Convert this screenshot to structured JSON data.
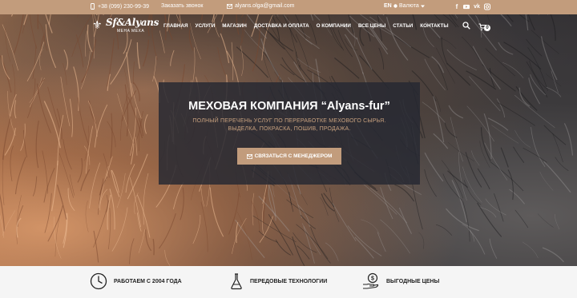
{
  "topbar": {
    "phone": "+38 (099) 230-99-39",
    "callback": "Заказать звонок",
    "email": "alyans.olga@gmail.com",
    "language": "EN",
    "currency": "Валюта",
    "socials": [
      "facebook-icon",
      "youtube-icon",
      "vk-icon",
      "instagram-icon"
    ]
  },
  "logo": {
    "brand": "Sf&Alyans",
    "sub": "MEHA MEXA"
  },
  "nav": {
    "items": [
      "ГЛАВНАЯ",
      "УСЛУГИ",
      "МАГАЗИН",
      "ДОСТАВКА И ОПЛАТА",
      "О КОМПАНИИ",
      "ВСЕ ЦЕНЫ",
      "СТАТЬИ",
      "КОНТАКТЫ"
    ],
    "cart_count": "0"
  },
  "hero": {
    "title": "МЕХОВАЯ КОМПАНИЯ “Alyans-fur”",
    "subtitle_line1": "ПОЛНЫЙ ПЕРЕЧЕНЬ УСЛУГ ПО ПЕРЕРАБОТКЕ МЕХОВОГО СЫРЬЯ.",
    "subtitle_line2": "ВЫДЕЛКА, ПОКРАСКА, ПОШИВ, ПРОДАЖА.",
    "button_label": "СВЯЗАТЬСЯ С МЕНЕДЖЕРОМ"
  },
  "features": [
    {
      "icon": "clock-icon",
      "label": "РАБОТАЕМ С 2004 ГОДА"
    },
    {
      "icon": "flask-icon",
      "label": "ПЕРЕДОВЫЕ ТЕХНОЛОГИИ"
    },
    {
      "icon": "money-hand-icon",
      "label": "ВЫГОДНЫЕ ЦЕНЫ"
    }
  ],
  "colors": {
    "accent": "#c29c7c",
    "promo_bg": "#262832",
    "promo_subtitle": "#c9a27f"
  }
}
